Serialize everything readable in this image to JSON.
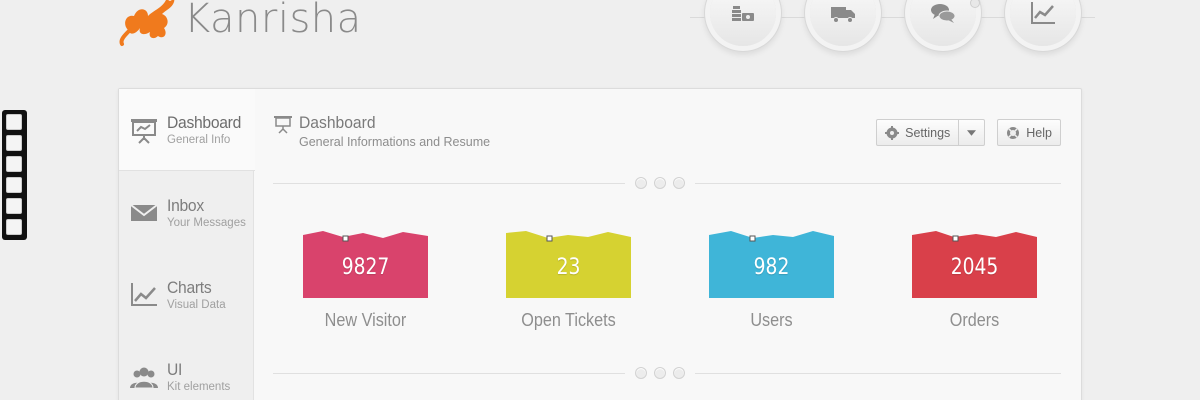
{
  "app": {
    "name": "Kanrisha"
  },
  "top_nav": [
    {
      "icon": "money-stack-icon"
    },
    {
      "icon": "truck-icon"
    },
    {
      "icon": "chat-bubbles-icon"
    },
    {
      "icon": "line-chart-icon"
    }
  ],
  "sidebar": {
    "items": [
      {
        "label": "Dashboard",
        "sub": "General Info",
        "icon": "presentation-board-icon"
      },
      {
        "label": "Inbox",
        "sub": "Your Messages",
        "icon": "envelope-icon"
      },
      {
        "label": "Charts",
        "sub": "Visual Data",
        "icon": "line-chart-icon"
      },
      {
        "label": "UI",
        "sub": "Kit elements",
        "icon": "users-group-icon"
      }
    ]
  },
  "content": {
    "title": "Dashboard",
    "subtitle": "General Informations and Resume",
    "settings_label": "Settings",
    "help_label": "Help"
  },
  "stats": [
    {
      "value": "9827",
      "label": "New Visitor",
      "color": "#d9436c"
    },
    {
      "value": "23",
      "label": "Open Tickets",
      "color": "#d6d231"
    },
    {
      "value": "982",
      "label": "Users",
      "color": "#3fb5d8"
    },
    {
      "value": "2045",
      "label": "Orders",
      "color": "#d9404a"
    }
  ]
}
